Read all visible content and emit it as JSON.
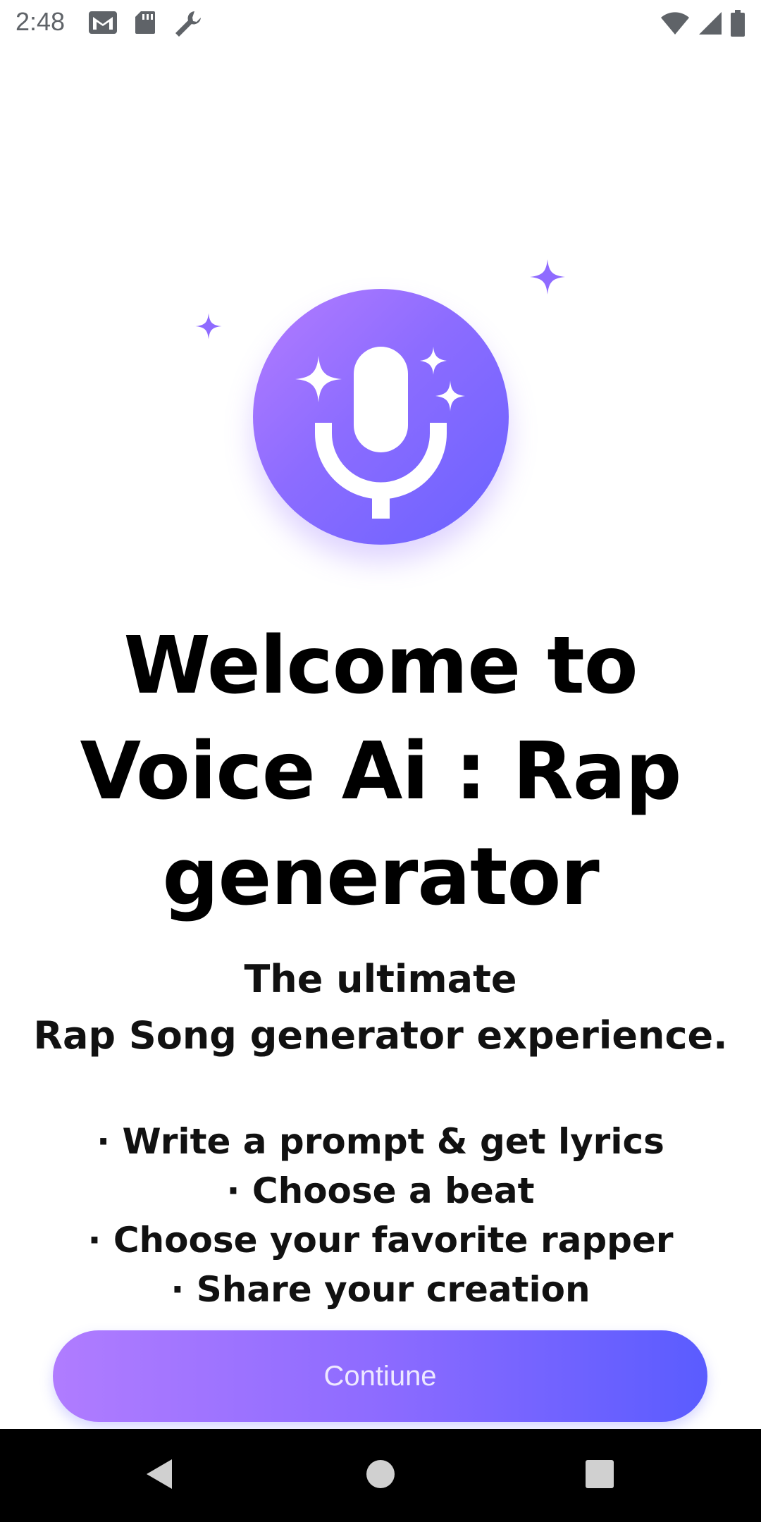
{
  "status_bar": {
    "time": "2:48",
    "left_icons": [
      "gmail-icon",
      "sd-card-icon",
      "wrench-icon"
    ],
    "right_icons": [
      "wifi-icon",
      "signal-icon",
      "battery-icon"
    ]
  },
  "hero": {
    "icon": "microphone-sparkles-icon",
    "gradient_start": "#b47cff",
    "gradient_end": "#6a62ff",
    "sparkle_color": "#8f6bff"
  },
  "title_lines": [
    "Welcome to",
    "Voice Ai : Rap",
    "generator"
  ],
  "subtitle_lines": [
    "The ultimate",
    "Rap Song generator experience."
  ],
  "features": [
    "· Write a prompt & get lyrics",
    "·  Choose a beat",
    "· Choose your favorite rapper",
    "· Share your creation"
  ],
  "continue_button": {
    "label": "Contiune",
    "gradient_start": "#b07cff",
    "gradient_end": "#5a5cff"
  },
  "nav_bar": {
    "buttons": [
      "back-icon",
      "home-icon",
      "recents-icon"
    ]
  }
}
